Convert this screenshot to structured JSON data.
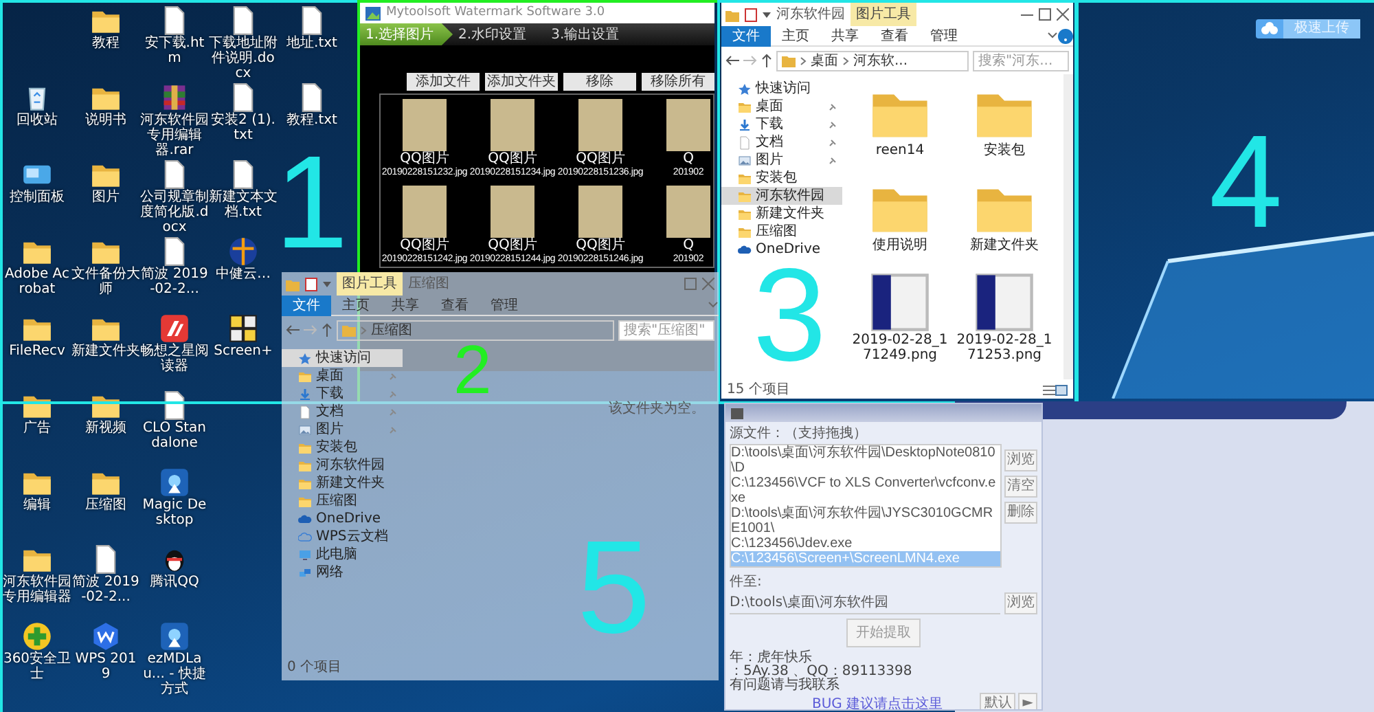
{
  "zones": [
    {
      "number": "1",
      "color": "#22e6e6"
    },
    {
      "number": "2",
      "color": "#22ee22"
    },
    {
      "number": "3",
      "color": "#22e6e6"
    },
    {
      "number": "4",
      "color": "#22e6e6"
    },
    {
      "number": "5",
      "color": "#22e6e6"
    }
  ],
  "desktop": {
    "icon_columns": [
      [
        {
          "label": "回收站",
          "kind": "recycle_bin"
        },
        {
          "label": "控制面板",
          "kind": "control_panel"
        },
        {
          "label": "Adobe Acrobat",
          "kind": "folder"
        },
        {
          "label": "FileRecv",
          "kind": "folder"
        },
        {
          "label": "广告",
          "kind": "folder"
        },
        {
          "label": "编辑",
          "kind": "folder"
        },
        {
          "label": "河东软件园专用编辑器",
          "kind": "folder"
        },
        {
          "label": "360安全卫士",
          "kind": "plus_app"
        }
      ],
      [
        {
          "label": "教程",
          "kind": "folder"
        },
        {
          "label": "说明书",
          "kind": "folder"
        },
        {
          "label": "图片",
          "kind": "folder"
        },
        {
          "label": "文件备份大师",
          "kind": "folder"
        },
        {
          "label": "新建文件夹",
          "kind": "folder"
        },
        {
          "label": "新视频",
          "kind": "folder"
        },
        {
          "label": "压缩图",
          "kind": "folder"
        },
        {
          "label": "简波 2019-02-2...",
          "kind": "document"
        },
        {
          "label": "WPS 2019",
          "kind": "wps_app"
        }
      ],
      [
        {
          "label": "安下载.htm",
          "kind": "document"
        },
        {
          "label": "河东软件园专用编辑器.rar",
          "kind": "archive"
        },
        {
          "label": "公司规章制度简化版.docx",
          "kind": "document"
        },
        {
          "label": "简波 2019-02-2...",
          "kind": "document"
        },
        {
          "label": "畅想之星阅读器",
          "kind": "reader_app"
        },
        {
          "label": "CLO Standalone",
          "kind": "document"
        },
        {
          "label": "Magic Desktop",
          "kind": "magic_app"
        },
        {
          "label": "腾讯QQ",
          "kind": "penguin_app"
        },
        {
          "label": "ezMDLau... - 快捷方式",
          "kind": "magic_app"
        }
      ],
      [
        {
          "label": "下载地址附件说明.docx",
          "kind": "document"
        },
        {
          "label": "安装2 (1).txt",
          "kind": "document"
        },
        {
          "label": "新建文本文档.txt",
          "kind": "document"
        },
        {
          "label": "中健云…",
          "kind": "globe_app"
        },
        {
          "label": "Screen+",
          "kind": "grid_app"
        }
      ],
      [
        {
          "label": "地址.txt",
          "kind": "document"
        },
        {
          "label": "教程.txt",
          "kind": "document"
        }
      ]
    ]
  },
  "watermark_app": {
    "title": "Mytoolsoft Watermark Software 3.0",
    "steps": [
      {
        "label": "1.选择图片",
        "selected": true
      },
      {
        "label": "2.水印设置",
        "selected": false
      },
      {
        "label": "3.输出设置",
        "selected": false
      }
    ],
    "buttons": [
      "添加文件",
      "添加文件夹",
      "移除",
      "移除所有"
    ],
    "thumbnails": [
      {
        "name": "QQ图片",
        "file": "20190228151232.jpg"
      },
      {
        "name": "QQ图片",
        "file": "20190228151234.jpg"
      },
      {
        "name": "QQ图片",
        "file": "20190228151236.jpg"
      },
      {
        "name": "Q",
        "file": "201902"
      },
      {
        "name": "QQ图片",
        "file": "20190228151242.jpg"
      },
      {
        "name": "QQ图片",
        "file": "20190228151244.jpg"
      },
      {
        "name": "QQ图片",
        "file": "20190228151246.jpg"
      },
      {
        "name": "Q",
        "file": "201902"
      }
    ]
  },
  "explorer": {
    "title": "河东软件园",
    "context_group": "图片工具",
    "tabs": [
      {
        "label": "文件",
        "selected": true
      },
      {
        "label": "主页",
        "selected": false
      },
      {
        "label": "共享",
        "selected": false
      },
      {
        "label": "查看",
        "selected": false
      },
      {
        "label": "管理",
        "selected": false
      }
    ],
    "path": [
      "桌面",
      "河东软..."
    ],
    "search": {
      "placeholder": "搜索\"河东..."
    },
    "sidebar": [
      {
        "label": "快速访问",
        "kind": "star",
        "pinned": false,
        "selected": false
      },
      {
        "label": "桌面",
        "kind": "folder",
        "pinned": true,
        "selected": false
      },
      {
        "label": "下载",
        "kind": "download",
        "pinned": true,
        "selected": false
      },
      {
        "label": "文档",
        "kind": "document",
        "pinned": true,
        "selected": false
      },
      {
        "label": "图片",
        "kind": "picture",
        "pinned": true,
        "selected": false
      },
      {
        "label": "安装包",
        "kind": "folder",
        "pinned": false,
        "selected": false
      },
      {
        "label": "河东软件园",
        "kind": "folder",
        "pinned": false,
        "selected": true
      },
      {
        "label": "新建文件夹",
        "kind": "folder",
        "pinned": false,
        "selected": false
      },
      {
        "label": "压缩图",
        "kind": "folder",
        "pinned": false,
        "selected": false
      },
      {
        "label": "OneDrive",
        "kind": "cloud",
        "pinned": false,
        "selected": false
      }
    ],
    "items": [
      {
        "label": "reen14",
        "kind": "folder"
      },
      {
        "label": "安装包",
        "kind": "folder"
      },
      {
        "label": "使用说明",
        "kind": "folder"
      },
      {
        "label": "新建文件夹",
        "kind": "folder"
      },
      {
        "label": "2019-02-28_171249.png",
        "kind": "image"
      },
      {
        "label": "2019-02-28_171253.png",
        "kind": "image"
      }
    ],
    "status": "15 个项目"
  },
  "ghost_explorer": {
    "title": "压缩图",
    "context_group": "图片工具",
    "tabs": [
      {
        "label": "文件",
        "selected": true
      },
      {
        "label": "主页",
        "selected": false
      },
      {
        "label": "共享",
        "selected": false
      },
      {
        "label": "查看",
        "selected": false
      },
      {
        "label": "管理",
        "selected": false
      }
    ],
    "path": [
      "压缩图"
    ],
    "search": {
      "placeholder": "搜索\"压缩图\""
    },
    "sidebar": [
      {
        "label": "快速访问",
        "kind": "star",
        "pinned": false,
        "selected": true
      },
      {
        "label": "桌面",
        "kind": "folder",
        "pinned": true,
        "selected": false
      },
      {
        "label": "下载",
        "kind": "download",
        "pinned": true,
        "selected": false
      },
      {
        "label": "文档",
        "kind": "document",
        "pinned": true,
        "selected": false
      },
      {
        "label": "图片",
        "kind": "picture",
        "pinned": true,
        "selected": false
      },
      {
        "label": "安装包",
        "kind": "folder",
        "pinned": false,
        "selected": false
      },
      {
        "label": "河东软件园",
        "kind": "folder",
        "pinned": false,
        "selected": false
      },
      {
        "label": "新建文件夹",
        "kind": "folder",
        "pinned": false,
        "selected": false
      },
      {
        "label": "压缩图",
        "kind": "folder",
        "pinned": false,
        "selected": false
      },
      {
        "label": "OneDrive",
        "kind": "cloud",
        "pinned": false,
        "selected": false
      },
      {
        "label": "WPS云文档",
        "kind": "cloud_outline",
        "pinned": false,
        "selected": false
      },
      {
        "label": "此电脑",
        "kind": "computer",
        "pinned": false,
        "selected": false
      },
      {
        "label": "网络",
        "kind": "network",
        "pinned": false,
        "selected": false
      }
    ],
    "empty_text": "该文件夹为空。",
    "status": "0 个项目"
  },
  "upload_button": {
    "label": "极速上传"
  },
  "extractor_app": {
    "source_label": "源文件：（支持拖拽）",
    "files": [
      {
        "path": "D:\\tools\\桌面\\河东软件园\\DesktopNote0810\\D",
        "selected": false
      },
      {
        "path": "C:\\123456\\VCF to XLS Converter\\vcfconv.exe",
        "selected": false
      },
      {
        "path": "D:\\tools\\桌面\\河东软件园\\JYSC3010GCMRE1001\\",
        "selected": false
      },
      {
        "path": "C:\\123456\\Jdev.exe",
        "selected": false
      },
      {
        "path": "C:\\123456\\Screen+\\ScreenLMN4.exe",
        "selected": true
      }
    ],
    "side_buttons": [
      "浏览",
      "清空",
      "删除"
    ],
    "output_label": "件至:",
    "output_path": "D:\\tools\\桌面\\河东软件园",
    "output_browse": "浏览",
    "start_button": "开始提取",
    "notes": [
      "年：虎年快乐",
      "：5Ay.38 、QQ：89113398",
      "有问题请与我联系"
    ],
    "link": "BUG 建议请点击这里",
    "footer_buttons": [
      "默认",
      "►"
    ]
  }
}
